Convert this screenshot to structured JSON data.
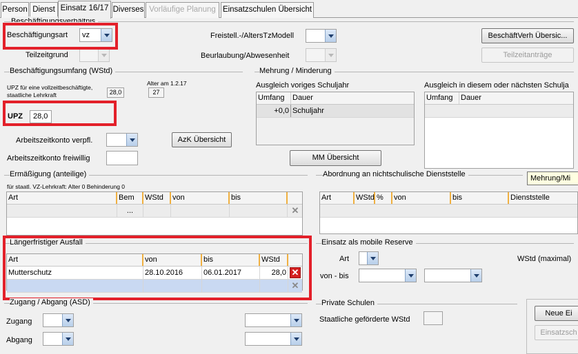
{
  "tabs": [
    "Person",
    "Dienst",
    "Einsatz 16/17",
    "Diverses",
    "Vorläufige Planung",
    "Einsatzschulen Übersicht"
  ],
  "sections": {
    "beschaeftigungsverhaeltnis": "Beschäftigungsverhältnis",
    "beschaeftigungsumfang": "Beschäftigungsumfang (WStd)",
    "mehrung": "Mehrung / Minderung",
    "ermaessigung": "Ermäßigung (anteilige)",
    "abordnung": "Abordnung an nichtschulische Dienststelle",
    "ausfall": "Längerfristiger Ausfall",
    "mobile_reserve": "Einsatz als mobile Reserve",
    "zugang_abgang": "Zugang / Abgang (ASD)",
    "private_schulen": "Private Schulen"
  },
  "beschaeftigung": {
    "art_label": "Beschäftigungsart",
    "art_value": "vz",
    "teilzeitgrund_label": "Teilzeitgrund",
    "freistell_label": "Freistell.-/AltersTzModell",
    "beurlaubung_label": "Beurlaubung/Abwesenheit",
    "uebersicht_button": "BeschäftVerh Übersic...",
    "teilzeitantraege_button": "Teilzeitanträge"
  },
  "umfang": {
    "upz_note_line1": "UPZ für eine vollzeitbeschäftigte,",
    "upz_note_line2": "staatliche Lehrkraft",
    "upz_reference": "28,0",
    "alter_label": "Alter am 1.2.17",
    "alter_value": "27",
    "upz_label": "UPZ",
    "upz_value": "28,0",
    "azk_verpfl_label": "Arbeitszeitkonto verpfl.",
    "azk_freiwillig_label": "Arbeitszeitkonto freiwillig",
    "azk_button": "AzK Übersicht"
  },
  "mehrung": {
    "voriges_label": "Ausgleich voriges Schuljahr",
    "naechstes_label": "Ausgleich in diesem oder nächsten Schulja",
    "col_umfang": "Umfang",
    "col_dauer": "Dauer",
    "row_umfang": "+0,0",
    "row_dauer": "Schuljahr",
    "mm_button": "MM Übersicht",
    "tooltip": "Mehrung/Mi"
  },
  "ermaessigung": {
    "note": "für staatl. VZ-Lehrkraft: Alter 0 Behinderung 0",
    "columns": [
      "Art",
      "Bem",
      "WStd",
      "von",
      "bis"
    ],
    "bem_button": "..."
  },
  "abordnung": {
    "columns": [
      "Art",
      "WStd",
      "%",
      "von",
      "bis",
      "Dienststelle"
    ]
  },
  "ausfall": {
    "columns": [
      "Art",
      "von",
      "bis",
      "WStd"
    ],
    "rows": [
      {
        "art": "Mutterschutz",
        "von": "28.10.2016",
        "bis": "06.01.2017",
        "wstd": "28,0"
      }
    ]
  },
  "mobile_reserve": {
    "art_label": "Art",
    "von_bis_label": "von - bis",
    "wstd_label": "WStd (maximal)"
  },
  "zugang": {
    "zugang_label": "Zugang",
    "abgang_label": "Abgang"
  },
  "private": {
    "wstd_label": "Staatliche geförderte WStd",
    "neue_button": "Neue Ei",
    "einsatz_button": "Einsatzsch"
  },
  "colors": {
    "highlight": "#e3202a",
    "accent_header_divider": "#f0b040",
    "delete_red": "#d42020"
  }
}
